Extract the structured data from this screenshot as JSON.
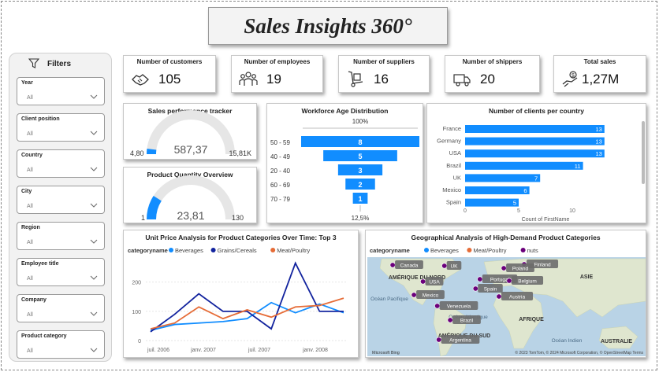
{
  "title": "Sales Insights 360°",
  "filters": {
    "heading": "Filters",
    "slicers": [
      {
        "label": "Year",
        "value": "All"
      },
      {
        "label": "Client position",
        "value": "All"
      },
      {
        "label": "Country",
        "value": "All"
      },
      {
        "label": "City",
        "value": "All"
      },
      {
        "label": "Region",
        "value": "All"
      },
      {
        "label": "Employee title",
        "value": "All"
      },
      {
        "label": "Company",
        "value": "All"
      },
      {
        "label": "Product category",
        "value": "All"
      }
    ]
  },
  "kpis": [
    {
      "label": "Number of customers",
      "value": "105",
      "icon": "handshake-icon"
    },
    {
      "label": "Number of employees",
      "value": "19",
      "icon": "team-icon"
    },
    {
      "label": "Number of suppliers",
      "value": "16",
      "icon": "hand-truck-icon"
    },
    {
      "label": "Number of shippers",
      "value": "20",
      "icon": "delivery-truck-icon"
    },
    {
      "label": "Total sales",
      "value": "1,27M",
      "icon": "money-hand-icon"
    }
  ],
  "gauges": [
    {
      "title": "Sales performance tracker",
      "value_label": "587,37",
      "min_label": "4,80",
      "max_label": "15,81K",
      "fill_fraction": 0.04
    },
    {
      "title": "Product Quantity Overview",
      "value_label": "23,81",
      "min_label": "1",
      "max_label": "130",
      "fill_fraction": 0.18
    }
  ],
  "funnel": {
    "title": "Workforce Age Distribution",
    "top_label": "100%",
    "bottom_label": "12,5%",
    "rows": [
      {
        "label": "50 - 59",
        "value": "8",
        "n": 8
      },
      {
        "label": "40 - 49",
        "value": "5",
        "n": 5
      },
      {
        "label": "20 - 40",
        "value": "3",
        "n": 3
      },
      {
        "label": "60 - 69",
        "value": "2",
        "n": 2
      },
      {
        "label": "70 - 79",
        "value": "1",
        "n": 1
      }
    ]
  },
  "chart_data": [
    {
      "type": "bar",
      "orientation": "horizontal",
      "title": "Number of clients per country",
      "xlabel": "Count of FirstName",
      "categories": [
        "France",
        "Germany",
        "USA",
        "Brazil",
        "UK",
        "Mexico",
        "Spain"
      ],
      "values": [
        13,
        13,
        13,
        11,
        7,
        6,
        5
      ],
      "x_ticks": [
        "0",
        "5",
        "10"
      ],
      "xlim": [
        0,
        15
      ],
      "color": "#118DFF"
    },
    {
      "type": "line",
      "title": "Unit Price Analysis for Product Categories Over Time: Top 3",
      "legend_title": "categoryname",
      "x_ticks": [
        "juil. 2006",
        "janv. 2007",
        "juil. 2007",
        "janv. 2008"
      ],
      "y_ticks": [
        "0",
        "100",
        "200"
      ],
      "ylim": [
        0,
        280
      ],
      "series": [
        {
          "name": "Beverages",
          "color": "#118DFF",
          "values": [
            35,
            55,
            60,
            65,
            75,
            130,
            95,
            125,
            95
          ]
        },
        {
          "name": "Grains/Cereals",
          "color": "#12239E",
          "values": [
            30,
            90,
            160,
            100,
            100,
            40,
            265,
            100,
            100
          ]
        },
        {
          "name": "Meat/Poultry",
          "color": "#E66C37",
          "values": [
            40,
            60,
            115,
            75,
            105,
            80,
            115,
            120,
            145
          ]
        }
      ]
    }
  ],
  "map": {
    "title": "Geographical Analysis of High-Demand Product Categories",
    "legend_title": "categoryname",
    "legend": [
      {
        "name": "Beverages",
        "color": "#118DFF"
      },
      {
        "name": "Meat/Poultry",
        "color": "#E66C37"
      },
      {
        "name": "nuts",
        "color": "#6B007B"
      }
    ],
    "country_tags": [
      "Canada",
      "UK",
      "Finland",
      "Poland",
      "Portugal",
      "Belgium",
      "USA",
      "Spain",
      "Austria",
      "Mexico",
      "Venezuela",
      "Brazil",
      "Argentina"
    ],
    "region_labels": [
      "AMÉRIQUE DU NORD",
      "ASIE",
      "Océan Pacifique",
      "Océan Atlantique",
      "AFRIQUE",
      "AMÉRIQUE DU SUD",
      "Océan Indien",
      "AUSTRALIE"
    ],
    "attribution": "© 2023 TomTom, © 2024 Microsoft Corporation, © OpenStreetMap Terms",
    "brand": "Microsoft Bing"
  }
}
